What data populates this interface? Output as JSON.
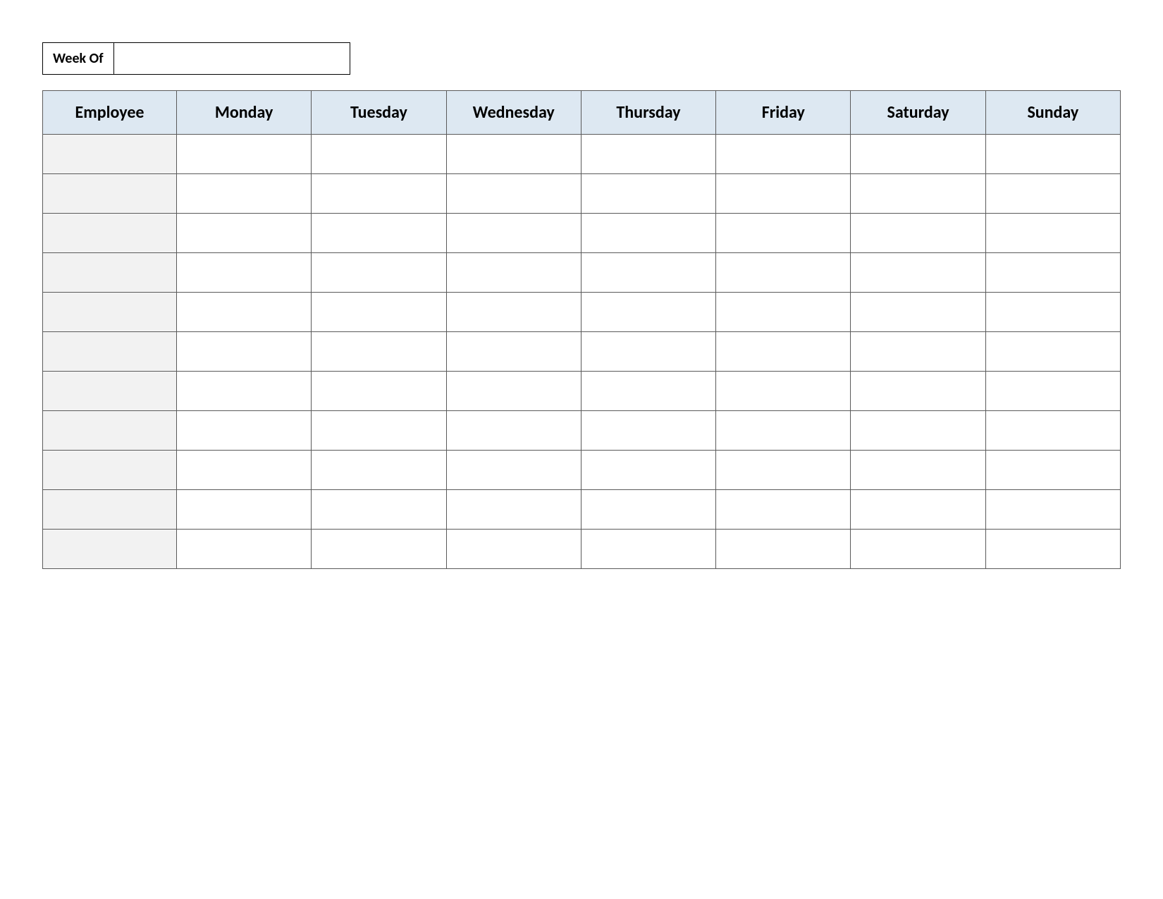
{
  "weekOf": {
    "label": "Week Of",
    "value": ""
  },
  "columns": [
    "Employee",
    "Monday",
    "Tuesday",
    "Wednesday",
    "Thursday",
    "Friday",
    "Saturday",
    "Sunday"
  ],
  "rows": [
    {
      "employee": "",
      "mon": "",
      "tue": "",
      "wed": "",
      "thu": "",
      "fri": "",
      "sat": "",
      "sun": ""
    },
    {
      "employee": "",
      "mon": "",
      "tue": "",
      "wed": "",
      "thu": "",
      "fri": "",
      "sat": "",
      "sun": ""
    },
    {
      "employee": "",
      "mon": "",
      "tue": "",
      "wed": "",
      "thu": "",
      "fri": "",
      "sat": "",
      "sun": ""
    },
    {
      "employee": "",
      "mon": "",
      "tue": "",
      "wed": "",
      "thu": "",
      "fri": "",
      "sat": "",
      "sun": ""
    },
    {
      "employee": "",
      "mon": "",
      "tue": "",
      "wed": "",
      "thu": "",
      "fri": "",
      "sat": "",
      "sun": ""
    },
    {
      "employee": "",
      "mon": "",
      "tue": "",
      "wed": "",
      "thu": "",
      "fri": "",
      "sat": "",
      "sun": ""
    },
    {
      "employee": "",
      "mon": "",
      "tue": "",
      "wed": "",
      "thu": "",
      "fri": "",
      "sat": "",
      "sun": ""
    },
    {
      "employee": "",
      "mon": "",
      "tue": "",
      "wed": "",
      "thu": "",
      "fri": "",
      "sat": "",
      "sun": ""
    },
    {
      "employee": "",
      "mon": "",
      "tue": "",
      "wed": "",
      "thu": "",
      "fri": "",
      "sat": "",
      "sun": ""
    },
    {
      "employee": "",
      "mon": "",
      "tue": "",
      "wed": "",
      "thu": "",
      "fri": "",
      "sat": "",
      "sun": ""
    },
    {
      "employee": "",
      "mon": "",
      "tue": "",
      "wed": "",
      "thu": "",
      "fri": "",
      "sat": "",
      "sun": ""
    }
  ]
}
